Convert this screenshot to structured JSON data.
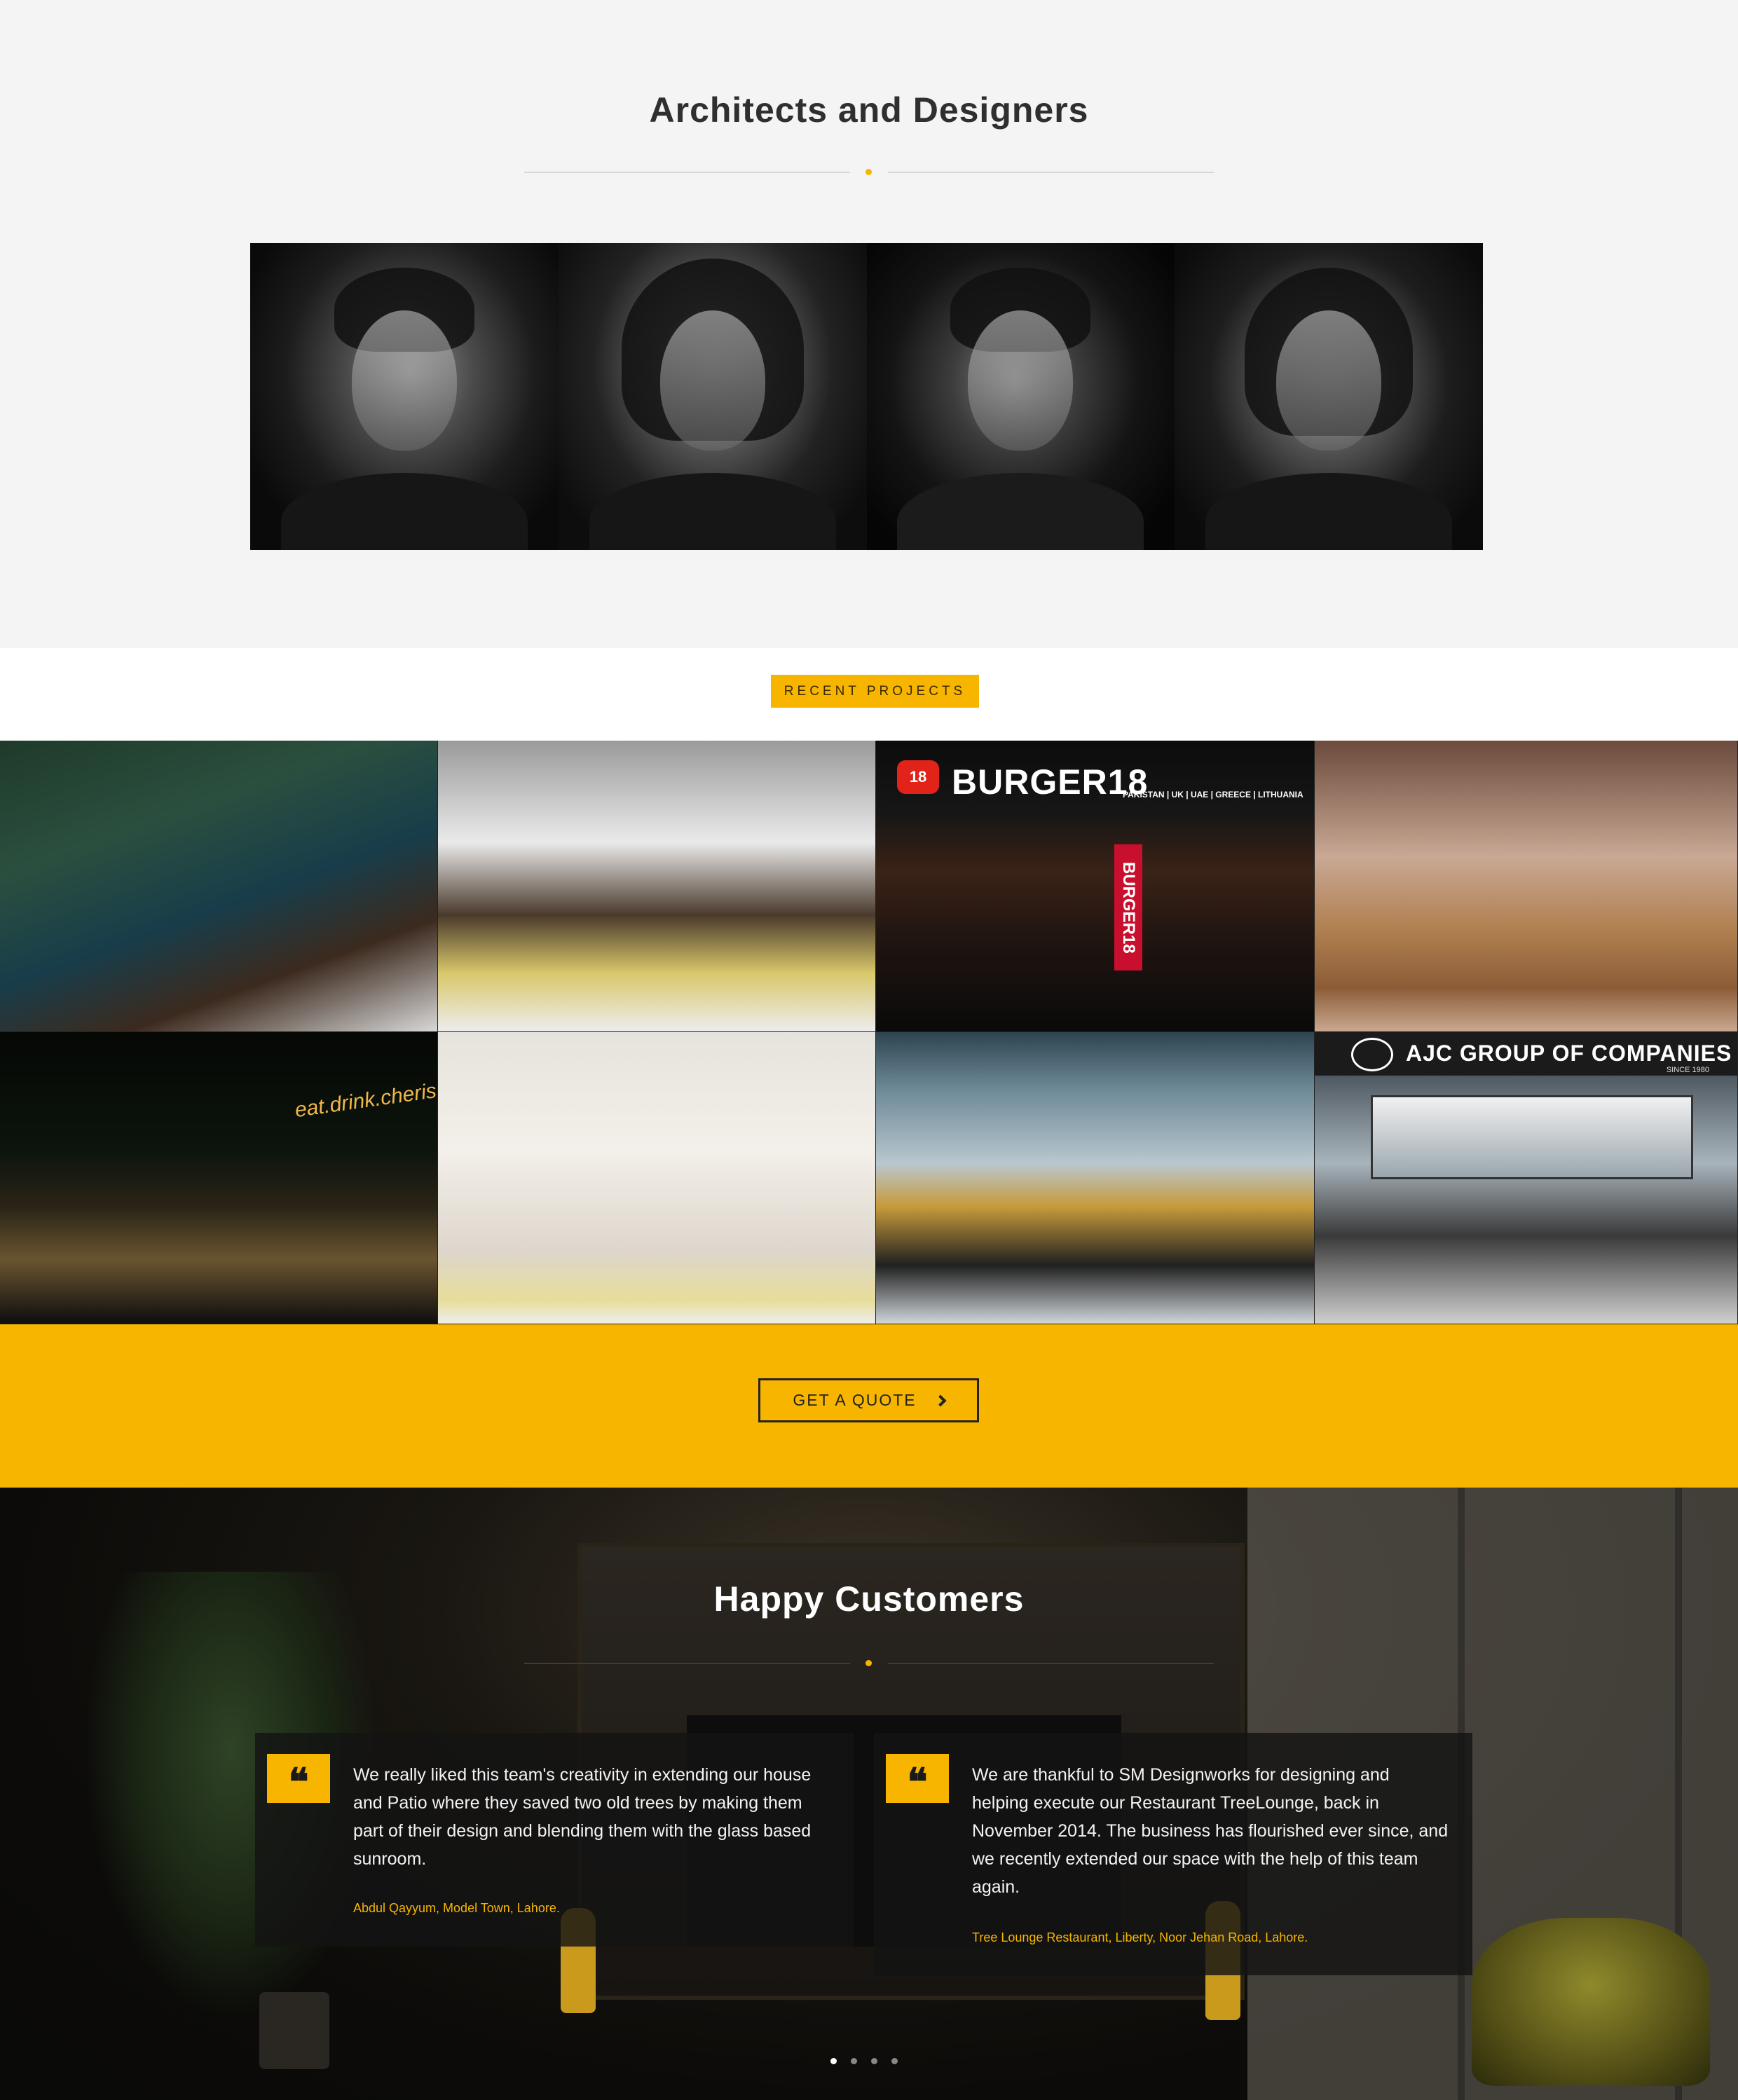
{
  "architects": {
    "title": "Architects and Designers",
    "team": [
      {
        "name": "architect-1"
      },
      {
        "name": "architect-2"
      },
      {
        "name": "architect-3"
      },
      {
        "name": "architect-4"
      }
    ]
  },
  "projects": {
    "badge": "RECENT PROJECTS",
    "burger": {
      "logo": "18",
      "name": "BURGER18",
      "countries": "PAKISTAN | UK | UAE | GREECE | LITHUANIA"
    },
    "ajc": {
      "name": "AJC GROUP OF COMPANIES",
      "since": "SINCE 1980"
    },
    "eat_sign": "eat.drink.cherish"
  },
  "quote_band": {
    "button_label": "GET A QUOTE"
  },
  "customers": {
    "title": "Happy Customers",
    "testimonials": [
      {
        "mark": "❝",
        "text": "We really liked this team's creativity in extending our house and Patio where they saved two old trees by making them part of their design and blending them with the glass based sunroom.",
        "author": "Abdul Qayyum, Model Town, Lahore."
      },
      {
        "mark": "❝",
        "text": "We are thankful to SM Designworks for designing and helping execute our Restaurant TreeLounge, back in November 2014. The business has flourished ever since, and we recently extended our space with the help of this team again.",
        "author": "Tree Lounge Restaurant, Liberty, Noor Jehan Road, Lahore."
      }
    ],
    "pager": {
      "count": 4,
      "active": 0
    }
  },
  "colors": {
    "accent": "#f7b500",
    "dark": "#0c0b09",
    "light_bg": "#f4f4f4"
  }
}
